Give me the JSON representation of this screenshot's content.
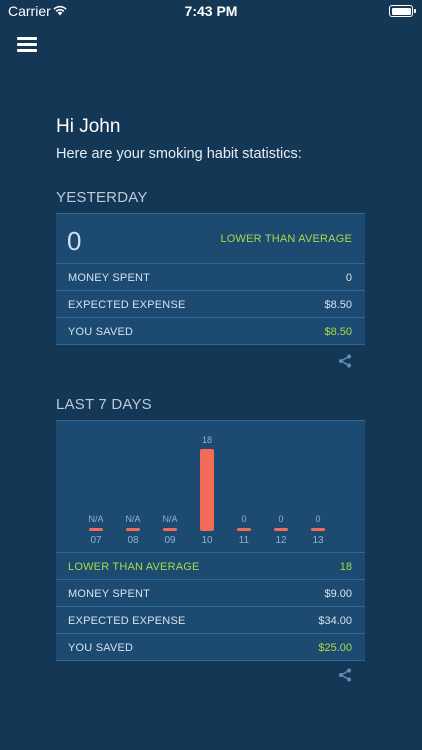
{
  "status_bar": {
    "carrier": "Carrier",
    "time": "7:43 PM"
  },
  "greeting": "Hi John",
  "subtitle": "Here are your smoking habit statistics:",
  "yesterday": {
    "title": "YESTERDAY",
    "count": "0",
    "status": "LOWER THAN AVERAGE",
    "rows": [
      {
        "label": "MONEY SPENT",
        "value": "0"
      },
      {
        "label": "EXPECTED EXPENSE",
        "value": "$8.50"
      },
      {
        "label": "YOU SAVED",
        "value": "$8.50"
      }
    ]
  },
  "last7": {
    "title": "LAST 7 DAYS",
    "status": "LOWER THAN AVERAGE",
    "status_value": "18",
    "rows": [
      {
        "label": "MONEY SPENT",
        "value": "$9.00"
      },
      {
        "label": "EXPECTED EXPENSE",
        "value": "$34.00"
      },
      {
        "label": "YOU SAVED",
        "value": "$25.00"
      }
    ]
  },
  "chart_data": {
    "type": "bar",
    "categories": [
      "07",
      "08",
      "09",
      "10",
      "11",
      "12",
      "13"
    ],
    "values": [
      null,
      null,
      null,
      18,
      0,
      0,
      0
    ],
    "value_labels": [
      "N/A",
      "N/A",
      "N/A",
      "18",
      "0",
      "0",
      "0"
    ],
    "ylim": [
      0,
      18
    ],
    "bar_color": "#f26b57"
  },
  "colors": {
    "background": "#143756",
    "card": "#1c4a70",
    "accent_green": "#a9d94a",
    "bar": "#f26b57"
  }
}
